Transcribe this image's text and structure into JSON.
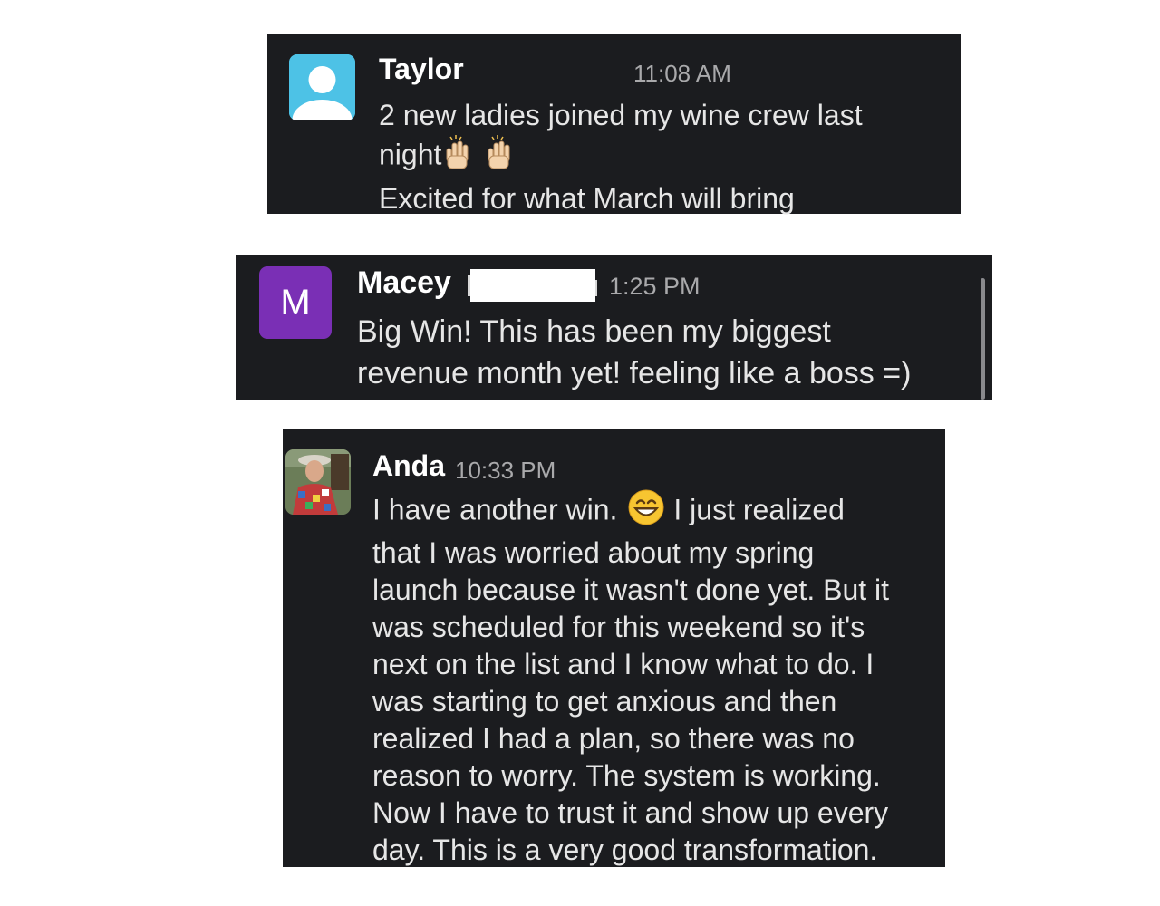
{
  "messages": [
    {
      "author": "Taylor",
      "time": "11:08 AM",
      "avatar": {
        "type": "default-user",
        "color": "#4dc2e6"
      },
      "lines": [
        "2 new ladies joined my wine crew last",
        "night",
        "Excited for what March will bring"
      ],
      "emoji": "raising-hands-emoji"
    },
    {
      "author": "Macey",
      "time": "1:25 PM",
      "avatar": {
        "type": "letter",
        "letter": "M",
        "color": "#7a2fb5"
      },
      "lines": [
        "Big Win! This has been my biggest",
        "revenue month yet! feeling like a boss =)"
      ]
    },
    {
      "author": "Anda",
      "time": "10:33 PM",
      "avatar": {
        "type": "photo"
      },
      "first_line_before_emoji": "I have another win.",
      "first_line_after_emoji": "I just realized",
      "emoji": "grinning-face-emoji",
      "lines": [
        "that I was worried about my spring",
        "launch because it wasn't done yet. But it",
        "was scheduled for this weekend so it's",
        "next on the list and I know what to do. I",
        "was starting to get anxious and then",
        "realized I had a plan, so there was no",
        "reason to worry. The system is working.",
        "Now I have to trust it and show up every",
        "day. This is a very good transformation."
      ]
    }
  ],
  "colors": {
    "card_bg": "#1b1c1f",
    "text": "#e6e6e6",
    "timestamp": "#a9a9ab"
  }
}
